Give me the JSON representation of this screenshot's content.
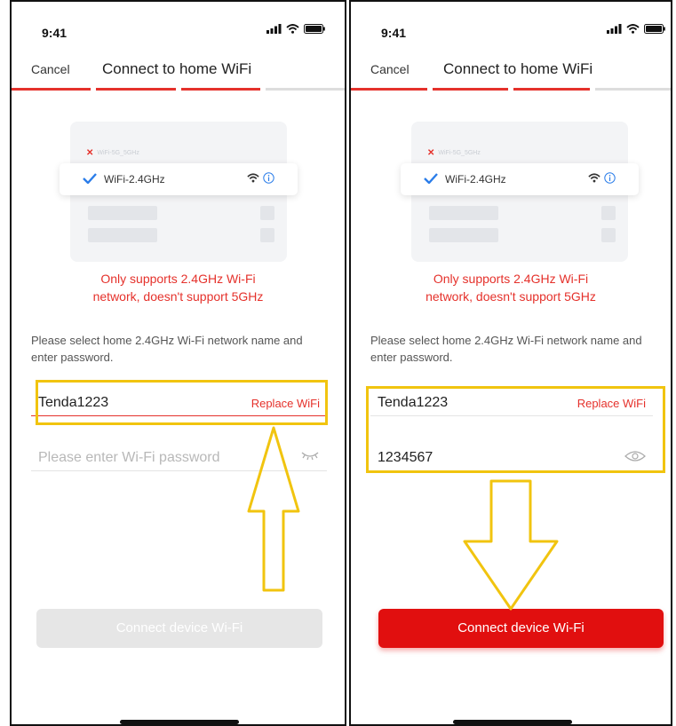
{
  "status_bar": {
    "time": "9:41"
  },
  "nav": {
    "cancel_label": "Cancel",
    "title": "Connect to home WiFi"
  },
  "progress": {
    "total_steps": 4,
    "completed_steps": 3
  },
  "illustration": {
    "rejected_network": "WiFi-5G_5GHz",
    "selected_network": "WiFi-2.4GHz"
  },
  "warning": {
    "line1": "Only supports 2.4GHz Wi-Fi",
    "line2": "network, doesn't support 5GHz"
  },
  "instruction": "Please select home 2.4GHz Wi-Fi network name and enter password.",
  "form": {
    "ssid": "Tenda1223",
    "replace_label": "Replace WiFi",
    "password_placeholder": "Please enter Wi-Fi password",
    "password_value": "1234567"
  },
  "connect_button": {
    "label": "Connect device Wi-Fi"
  },
  "colors": {
    "accent": "#e5312b",
    "button_active": "#e10f0f",
    "button_disabled": "#e6e6e6",
    "highlight": "#f1c40f"
  },
  "screens": [
    {
      "state": "before",
      "password_filled": false,
      "button_enabled": false,
      "annotation": "arrow-up-icon"
    },
    {
      "state": "after",
      "password_filled": true,
      "button_enabled": true,
      "annotation": "arrow-down-icon"
    }
  ]
}
